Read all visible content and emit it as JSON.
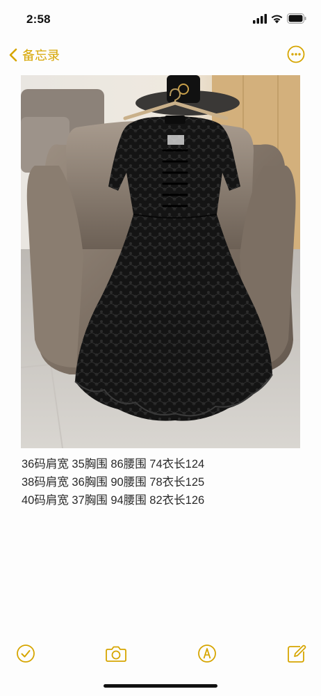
{
  "status_bar": {
    "time": "2:58"
  },
  "nav": {
    "back_label": "备忘录",
    "accent_color": "#d6a500",
    "back_icon": "chevron-left-icon",
    "more_icon": "ellipsis-circle-icon"
  },
  "note": {
    "image_alt": "black lace dress on chair",
    "lines": [
      "36码肩宽 35胸围 86腰围 74衣长124",
      "38码肩宽 36胸围 90腰围 78衣长125",
      "40码肩宽 37胸围 94腰围 82衣长126"
    ]
  },
  "toolbar": {
    "icons": [
      "checklist-icon",
      "camera-icon",
      "markup-pen-icon",
      "compose-icon"
    ]
  }
}
